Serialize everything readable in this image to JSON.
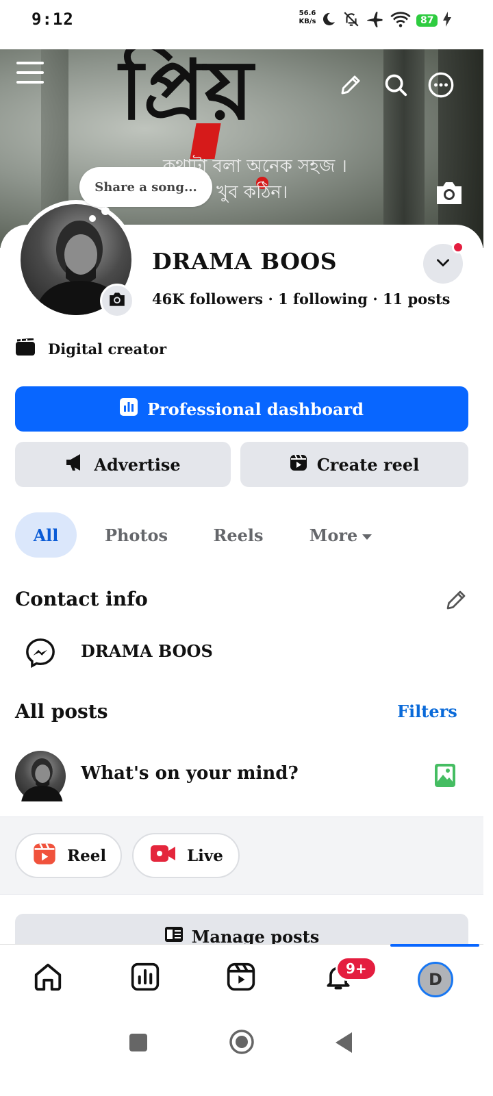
{
  "status_bar": {
    "time": "9:12",
    "net_speed_value": "56.6",
    "net_speed_unit": "KB/s",
    "battery": "87",
    "icons": [
      "moon-icon",
      "bell-off-icon",
      "airplane-icon",
      "wifi-icon",
      "charging-icon"
    ]
  },
  "cover": {
    "calligraphy": "প্রিয়",
    "line1": "কথাটা বলা অনেক সহজ ।",
    "line2": "খুব কঠিন।"
  },
  "profile": {
    "share_song": "Share a song...",
    "name": "DRAMA BOOS",
    "followers": "46K followers",
    "following": "1 following",
    "posts": "11 posts",
    "separator": "·",
    "category": "Digital creator"
  },
  "actions": {
    "professional_dashboard": "Professional dashboard",
    "advertise": "Advertise",
    "create_reel": "Create reel"
  },
  "tabs": [
    {
      "label": "All",
      "active": true
    },
    {
      "label": "Photos",
      "active": false
    },
    {
      "label": "Reels",
      "active": false
    },
    {
      "label": "More",
      "active": false
    }
  ],
  "contact_info": {
    "title": "Contact info",
    "messenger_name": "DRAMA BOOS"
  },
  "posts": {
    "title": "All posts",
    "filters": "Filters",
    "composer_placeholder": "What's on your mind?",
    "reel_label": "Reel",
    "live_label": "Live",
    "manage_posts": "Manage posts"
  },
  "bottom_nav": {
    "notifications_badge": "9+",
    "profile_initial": "D"
  },
  "colors": {
    "accent": "#0866ff",
    "tab_active_bg": "#dbe7fb",
    "badge_red": "#e41e3f",
    "photo_green": "#45bd62"
  }
}
